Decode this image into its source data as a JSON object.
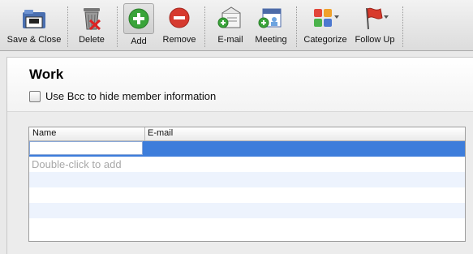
{
  "toolbar": {
    "save_close": "Save & Close",
    "delete": "Delete",
    "add": "Add",
    "remove": "Remove",
    "email": "E-mail",
    "meeting": "Meeting",
    "categorize": "Categorize",
    "follow_up": "Follow Up"
  },
  "group": {
    "title": "Work",
    "bcc_label": "Use Bcc to hide member information",
    "bcc_checked": false
  },
  "table": {
    "columns": [
      "Name",
      "E-mail"
    ],
    "new_name_value": "",
    "placeholder_hint": "Double-click to add"
  },
  "icons": {
    "save_close": "save-close-icon",
    "delete": "trash-icon",
    "add": "plus-icon",
    "remove": "minus-icon",
    "email": "email-icon",
    "meeting": "calendar-icon",
    "categorize": "categorize-icon",
    "follow_up": "flag-icon"
  },
  "colors": {
    "selection": "#3d7ddb",
    "add_green": "#3aa43a",
    "remove_red": "#d63a2f",
    "flag_red": "#d83a2c"
  }
}
